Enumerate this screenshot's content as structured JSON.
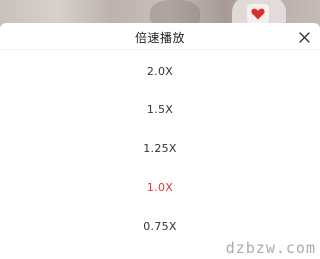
{
  "video": {
    "badge_icon": "heart-icon",
    "badge_color": "#d9302c"
  },
  "sheet": {
    "title": "倍速播放",
    "close_icon": "close-icon"
  },
  "speed_options": [
    {
      "label": "2.0X",
      "selected": false
    },
    {
      "label": "1.5X",
      "selected": false
    },
    {
      "label": "1.25X",
      "selected": false
    },
    {
      "label": "1.0X",
      "selected": true
    },
    {
      "label": "0.75X",
      "selected": false
    }
  ],
  "colors": {
    "selected": "#e8363a",
    "normal": "#333333"
  },
  "watermark": "dzbzw.com"
}
